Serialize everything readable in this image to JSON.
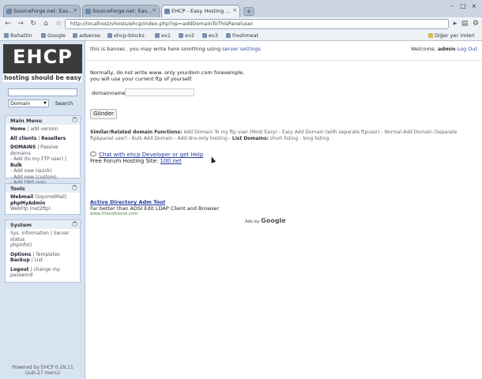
{
  "tabs": [
    {
      "label": "SourceForge.net: Eas..."
    },
    {
      "label": "SourceForge.net: Eas..."
    },
    {
      "label": "EHCP - Easy Hosting ..."
    }
  ],
  "address": {
    "url": "http://localhost/vhosts/ehcp/index.php?op=addDomainToThisPaneluser"
  },
  "bookmarks": [
    {
      "label": "Bahattin"
    },
    {
      "label": "Google"
    },
    {
      "label": "adsense"
    },
    {
      "label": "ehcp-blocks"
    },
    {
      "label": "ev1"
    },
    {
      "label": "ev2"
    },
    {
      "label": "ev3"
    },
    {
      "label": "freshmeat"
    }
  ],
  "other_bookmarks": "Diğer yer imleri",
  "logo": {
    "text": "EHCP",
    "tagline": "hosting should be easy"
  },
  "search": {
    "select_value": "Domain",
    "button": "Search"
  },
  "main_menu": {
    "title": "Main Menu",
    "home": "Home",
    "home_sep": " | ",
    "add_version": "add version",
    "all_clients": "All clients",
    "clients_sep": " | ",
    "resellers": "Resellers",
    "domains": "DOMAINS",
    "domains_sep": " | ",
    "passive_domains": "Passive domains",
    "add_to_ftp": "- Add (to my FTP user)",
    "add_to_ftp_sep": " | ",
    "bulk": "Bulk",
    "add_quick": "- Add new (quick)",
    "add_custom": "- Add new (custom)",
    "add_dns": "- Add DNS only"
  },
  "tools": {
    "title": "Tools",
    "webmail": "Webmail",
    "webmail_note": " (SquirrelMail)",
    "phpmyadmin": "phpMyAdmin",
    "webftp": "WebFtp (net2ftp)"
  },
  "system": {
    "title": "System",
    "sys_info": "Sys. information",
    "sys_sep": " | ",
    "server_status": "Server status",
    "phpinfo": "phpinfo()",
    "options": "Options",
    "options_sep": " | ",
    "templates": "Templates",
    "backup": "Backup",
    "backup_sep": " | ",
    "list": "List",
    "logout": "Logout",
    "logout_sep": " | ",
    "change_pw": "change my password"
  },
  "powered_by": {
    "line1": "Powered by EHCP 0.29.11",
    "line2": "(sub-27 menu)"
  },
  "banner": {
    "text": "this is banner.. you may write here somthing using ",
    "link": "server settings"
  },
  "welcome": {
    "prefix": "Welcome, ",
    "user": "admin",
    "logout": "Log Out"
  },
  "form": {
    "note_line1": "Normally, do not write www. only yourdom.com forexemple.",
    "note_line2": "you will use your current ftp of yourself:",
    "domain_label": "domainname",
    "submit": "Gönder"
  },
  "similar": {
    "prefix": "Similar/Related domain Functions: ",
    "links": "Add Domain To my ftp user (Most Easy) - Easy Add Domain (with separate ftpuser) - Normal Add Domain (Separate ftp&panel user) - Bulk Add Domain - Add dns-only hosting - ",
    "list_label": "List Domains:",
    "list_links": " short listing - long listing"
  },
  "chat": {
    "link": "Chat with ehcp Developer or get Help"
  },
  "forum": {
    "prefix": "Free Forum Hosting Site: ",
    "link": "10tl.net"
  },
  "ad": {
    "title": "Active Directory Adm Tool",
    "desc": "Far better than ADSI Edit LDAP Client and Browser",
    "url": "www.thesoftzone.com"
  },
  "adsby": {
    "prefix": "Ads by ",
    "brand": "Google"
  }
}
